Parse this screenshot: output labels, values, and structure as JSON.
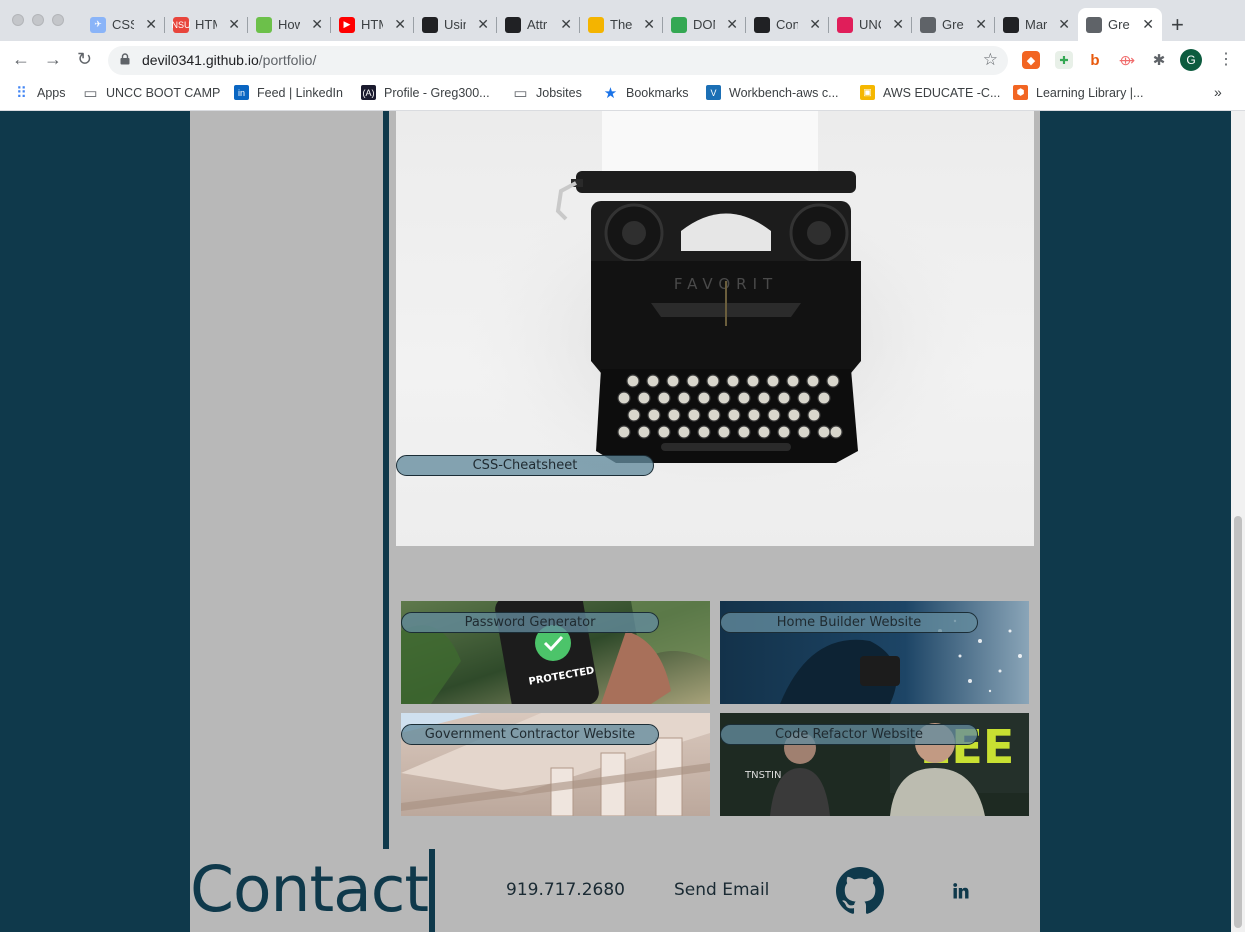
{
  "browser": {
    "tabs": [
      {
        "title": "CSS",
        "favicon_color": "#8ab4f8",
        "favicon": "✈"
      },
      {
        "title": "HTML",
        "favicon_color": "#e8453c",
        "favicon": "NSU"
      },
      {
        "title": "How",
        "favicon_color": "#6cc04a",
        "favicon": ""
      },
      {
        "title": "HTML",
        "favicon_color": "#ff0000",
        "favicon": "▶"
      },
      {
        "title": "Using",
        "favicon_color": "#202124",
        "favicon": ""
      },
      {
        "title": "Attr",
        "favicon_color": "#202124",
        "favicon": ""
      },
      {
        "title": "The",
        "favicon_color": "#f4b400",
        "favicon": ""
      },
      {
        "title": "DOM",
        "favicon_color": "#34a853",
        "favicon": ""
      },
      {
        "title": "Con",
        "favicon_color": "#202124",
        "favicon": ""
      },
      {
        "title": "UNC",
        "favicon_color": "#e01e5a",
        "favicon": ""
      },
      {
        "title": "Gre",
        "favicon_color": "#5f6368",
        "favicon": ""
      },
      {
        "title": "Mar",
        "favicon_color": "#202124",
        "favicon": ""
      },
      {
        "title": "Gre",
        "favicon_color": "#5f6368",
        "favicon": "",
        "active": true
      }
    ],
    "url_host": "devil0341.github.io",
    "url_path": "/portfolio/",
    "profile_initial": "G",
    "bookmarks": [
      {
        "label": "Apps",
        "icon": "apps-icon"
      },
      {
        "label": "UNCC BOOT CAMP",
        "icon": "folder-icon"
      },
      {
        "label": "Feed | LinkedIn",
        "icon": "linkedin-icon"
      },
      {
        "label": "Profile - Greg300...",
        "icon": "profile-icon"
      },
      {
        "label": "Jobsites",
        "icon": "folder-icon"
      },
      {
        "label": "Bookmarks",
        "icon": "star-icon"
      },
      {
        "label": "Workbench-aws c...",
        "icon": "vocareum-icon"
      },
      {
        "label": "AWS EDUCATE -C...",
        "icon": "aws-icon"
      },
      {
        "label": "Learning Library |...",
        "icon": "learning-icon"
      }
    ]
  },
  "portfolio": {
    "featured": {
      "label": "CSS-Cheatsheet"
    },
    "projects": [
      {
        "label": "Password Generator"
      },
      {
        "label": "Home Builder Website"
      },
      {
        "label": "Government Contractor Website"
      },
      {
        "label": "Code Refactor Website"
      }
    ]
  },
  "contact": {
    "title": "Contact",
    "phone": "919.717.2680",
    "email_label": "Send Email"
  },
  "colors": {
    "page_bg": "#0f394b",
    "content_bg": "#b8b8b8",
    "label_bg": "#648c9e"
  }
}
